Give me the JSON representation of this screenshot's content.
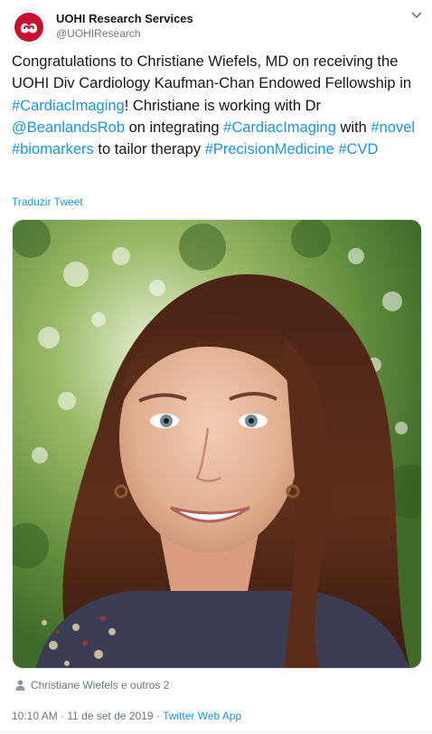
{
  "author": {
    "display_name": "UOHI Research Services",
    "handle": "@UOHIResearch",
    "avatar_icon": "uohi-logo-icon",
    "brand_color": "#c8102e"
  },
  "tweet": {
    "segments": [
      {
        "text": "Congratulations to Christiane Wiefels, MD on receiving the UOHI Div Cardiology Kaufman-Chan Endowed Fellowship in ",
        "link": false
      },
      {
        "text": "#CardiacImaging",
        "link": true
      },
      {
        "text": "! Christiane is working with Dr ",
        "link": false
      },
      {
        "text": "@BeanlandsRob",
        "link": true
      },
      {
        "text": " on integrating ",
        "link": false
      },
      {
        "text": "#CardiacImaging",
        "link": true
      },
      {
        "text": " with ",
        "link": false
      },
      {
        "text": "#novel",
        "link": true
      },
      {
        "text": " ",
        "link": false
      },
      {
        "text": "#biomarkers",
        "link": true
      },
      {
        "text": " to tailor therapy ",
        "link": false
      },
      {
        "text": "#PrecisionMedicine",
        "link": true
      },
      {
        "text": " ",
        "link": false
      },
      {
        "text": "#CVD",
        "link": true
      }
    ],
    "translate_label": "Traduzir Tweet",
    "tagged_label": "Christiane Wiefels e outros 2",
    "tagged_icon": "person-icon",
    "time": "10:10 AM",
    "separator": "·",
    "date": "11 de set de 2019",
    "source": "Twitter Web App",
    "link_color": "#1b95e0",
    "caret_icon": "chevron-down-icon"
  }
}
